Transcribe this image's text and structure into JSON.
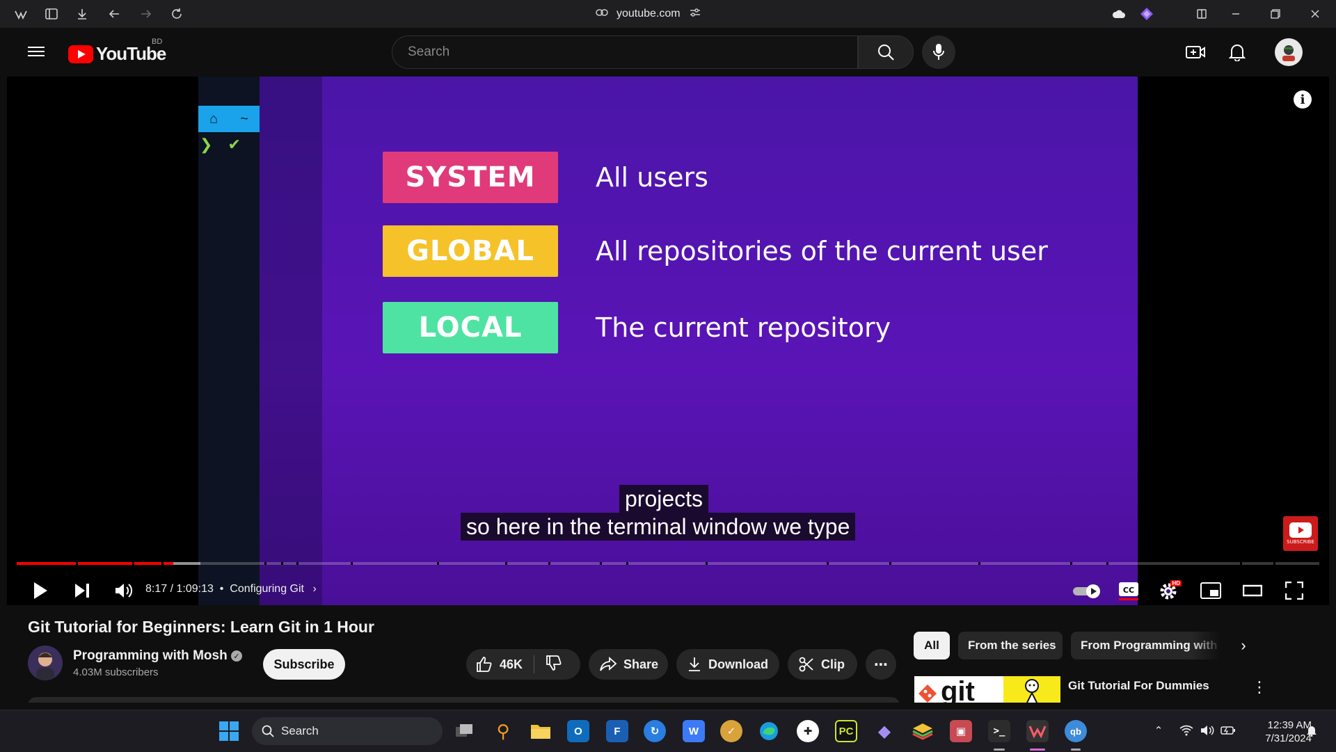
{
  "browser": {
    "url": "youtube.com"
  },
  "masthead": {
    "logo_text": "YouTube",
    "country_code": "BD",
    "search_placeholder": "Search"
  },
  "video_overlay": {
    "scopes": [
      {
        "label": "SYSTEM",
        "description": "All users",
        "color": "#e03a7a"
      },
      {
        "label": "GLOBAL",
        "description": "All repositories of the current user",
        "color": "#f5c22a"
      },
      {
        "label": "LOCAL",
        "description": "The current repository",
        "color": "#4fe3a3"
      }
    ],
    "captions": [
      "projects",
      "so here in the terminal window we type"
    ],
    "watermark_text": "SUBSCRIBE"
  },
  "player": {
    "time_current": "8:17",
    "time_total": "1:09:13",
    "chapter": "Configuring Git",
    "played_fraction": 0.12,
    "buffered_fraction": 0.141,
    "hd_badge": "HD",
    "accent_color": "#ff0000"
  },
  "video": {
    "title": "Git Tutorial for Beginners: Learn Git in 1 Hour",
    "channel_name": "Programming with Mosh",
    "subscriber_count": "4.03M subscribers",
    "subscribe_label": "Subscribe",
    "like_count": "46K",
    "share_label": "Share",
    "download_label": "Download",
    "clip_label": "Clip"
  },
  "sidebar": {
    "chips": [
      "All",
      "From the series",
      "From Programming with M"
    ],
    "related": [
      {
        "title": "Git Tutorial For Dummies",
        "thumb_text": "git"
      }
    ]
  },
  "taskbar": {
    "search_label": "Search",
    "time": "12:39 AM",
    "date": "7/31/2024"
  }
}
